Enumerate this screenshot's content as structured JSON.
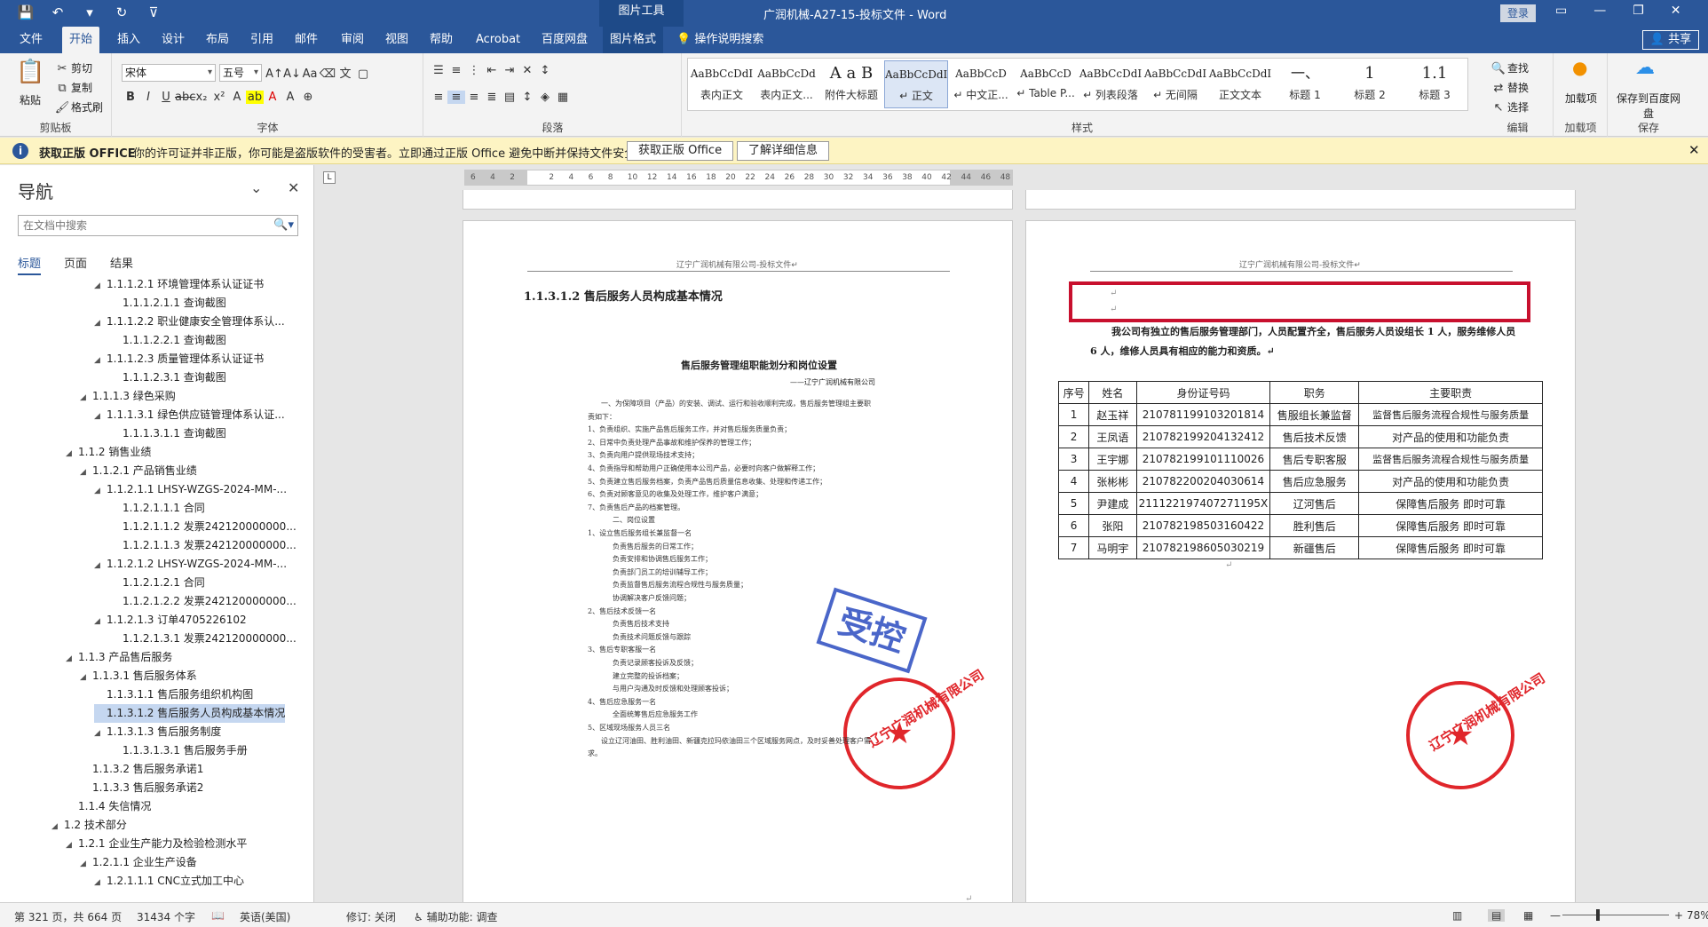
{
  "titlebar": {
    "qat": [
      "💾",
      "↶",
      "▾",
      "↻",
      "⊽"
    ],
    "context_header": "图片工具",
    "doc_title": "广润机械-A27-15-投标文件  -  Word",
    "login": "登录",
    "controls": [
      "▭",
      "—",
      "❐",
      "✕"
    ]
  },
  "tabs": [
    "文件",
    "开始",
    "插入",
    "设计",
    "布局",
    "引用",
    "邮件",
    "审阅",
    "视图",
    "帮助",
    "Acrobat",
    "百度网盘",
    "图片格式"
  ],
  "active_tab": "开始",
  "tell_me": "操作说明搜索",
  "share": "共享",
  "ribbon": {
    "clipboard": {
      "paste": "粘贴",
      "cut": "剪切",
      "copy": "复制",
      "format_painter": "格式刷",
      "label": "剪贴板"
    },
    "font": {
      "name": "宋体",
      "size": "五号",
      "label": "字体"
    },
    "paragraph": {
      "label": "段落"
    },
    "styles": {
      "label": "样式",
      "items": [
        {
          "sample": "AaBbCcDdI",
          "name": "表内正文"
        },
        {
          "sample": "AaBbCcDd",
          "name": "表内正文..."
        },
        {
          "sample": "A a B",
          "name": "附件大标题"
        },
        {
          "sample": "AaBbCcDdI",
          "name": "↵ 正文"
        },
        {
          "sample": "AaBbCcD",
          "name": "↵ 中文正..."
        },
        {
          "sample": "AaBbCcD",
          "name": "↵ Table P..."
        },
        {
          "sample": "AaBbCcDdI",
          "name": "↵ 列表段落"
        },
        {
          "sample": "AaBbCcDdI",
          "name": "↵ 无间隔"
        },
        {
          "sample": "AaBbCcDdI",
          "name": "正文文本"
        },
        {
          "sample": "一、",
          "name": "标题 1"
        },
        {
          "sample": "1",
          "name": "标题 2"
        },
        {
          "sample": "1.1",
          "name": "标题 3"
        }
      ]
    },
    "editing": {
      "find": "查找",
      "replace": "替换",
      "select": "选择",
      "label": "编辑"
    },
    "addins": {
      "addin": "加载项",
      "label": "加载项"
    },
    "save": {
      "save_baidu": "保存到百度网盘",
      "label": "保存"
    }
  },
  "infobar": {
    "title": "获取正版 OFFICE",
    "message": "你的许可证并非正版，你可能是盗版软件的受害者。立即通过正版 Office 避免中断并保持文件安全。",
    "btn_genuine": "获取正版 Office",
    "btn_learn": "了解详细信息"
  },
  "nav": {
    "title": "导航",
    "search_placeholder": "在文档中搜索",
    "tabs": [
      "标题",
      "页面",
      "结果"
    ],
    "items": [
      {
        "level": 3,
        "expand": true,
        "text": "1.1.1.2.1 环境管理体系认证证书"
      },
      {
        "level": 4,
        "expand": false,
        "text": "1.1.1.2.1.1 查询截图"
      },
      {
        "level": 3,
        "expand": true,
        "text": "1.1.1.2.2 职业健康安全管理体系认..."
      },
      {
        "level": 4,
        "expand": false,
        "text": "1.1.1.2.2.1 查询截图"
      },
      {
        "level": 3,
        "expand": true,
        "text": "1.1.1.2.3 质量管理体系认证证书"
      },
      {
        "level": 4,
        "expand": false,
        "text": "1.1.1.2.3.1 查询截图"
      },
      {
        "level": 2,
        "expand": true,
        "text": "1.1.1.3 绿色采购"
      },
      {
        "level": 3,
        "expand": true,
        "text": "1.1.1.3.1 绿色供应链管理体系认证..."
      },
      {
        "level": 4,
        "expand": false,
        "text": "1.1.1.3.1.1 查询截图"
      },
      {
        "level": 1,
        "expand": true,
        "text": "1.1.2 销售业绩"
      },
      {
        "level": 2,
        "expand": true,
        "text": "1.1.2.1 产品销售业绩"
      },
      {
        "level": 3,
        "expand": true,
        "text": "1.1.2.1.1 LHSY-WZGS-2024-MM-..."
      },
      {
        "level": 4,
        "expand": false,
        "text": "1.1.2.1.1.1 合同"
      },
      {
        "level": 4,
        "expand": false,
        "text": "1.1.2.1.1.2 发票242120000000..."
      },
      {
        "level": 4,
        "expand": false,
        "text": "1.1.2.1.1.3 发票242120000000..."
      },
      {
        "level": 3,
        "expand": true,
        "text": "1.1.2.1.2 LHSY-WZGS-2024-MM-..."
      },
      {
        "level": 4,
        "expand": false,
        "text": "1.1.2.1.2.1 合同"
      },
      {
        "level": 4,
        "expand": false,
        "text": "1.1.2.1.2.2 发票242120000000..."
      },
      {
        "level": 3,
        "expand": true,
        "text": "1.1.2.1.3 订单4705226102"
      },
      {
        "level": 4,
        "expand": false,
        "text": "1.1.2.1.3.1 发票242120000000..."
      },
      {
        "level": 1,
        "expand": true,
        "text": "1.1.3 产品售后服务"
      },
      {
        "level": 2,
        "expand": true,
        "text": "1.1.3.1 售后服务体系"
      },
      {
        "level": 3,
        "expand": false,
        "text": "1.1.3.1.1 售后服务组织机构图"
      },
      {
        "level": 3,
        "expand": false,
        "text": "1.1.3.1.2 售后服务人员构成基本情况",
        "selected": true
      },
      {
        "level": 3,
        "expand": true,
        "text": "1.1.3.1.3 售后服务制度"
      },
      {
        "level": 4,
        "expand": false,
        "text": "1.1.3.1.3.1 售后服务手册"
      },
      {
        "level": 2,
        "expand": false,
        "text": "1.1.3.2 售后服务承诺1"
      },
      {
        "level": 2,
        "expand": false,
        "text": "1.1.3.3 售后服务承诺2"
      },
      {
        "level": 1,
        "expand": false,
        "text": "1.1.4 失信情况"
      },
      {
        "level": 0,
        "expand": true,
        "text": "1.2 技术部分"
      },
      {
        "level": 1,
        "expand": true,
        "text": "1.2.1 企业生产能力及检验检测水平"
      },
      {
        "level": 2,
        "expand": true,
        "text": "1.2.1.1 企业生产设备"
      },
      {
        "level": 3,
        "expand": true,
        "text": "1.2.1.1.1 CNC立式加工中心"
      }
    ]
  },
  "ruler": [
    "6",
    "4",
    "2",
    "",
    "2",
    "4",
    "6",
    "8",
    "10",
    "12",
    "14",
    "16",
    "18",
    "20",
    "22",
    "24",
    "26",
    "28",
    "30",
    "32",
    "34",
    "36",
    "38",
    "40",
    "42",
    "44",
    "46",
    "48"
  ],
  "left_page": {
    "header": "辽宁广润机械有限公司-投标文件↵",
    "heading": "1.1.3.1.2  售后服务人员构成基本情况",
    "org_title": "售后服务管理组职能划分和岗位设置",
    "org_company": "——辽宁广润机械有限公司",
    "lines": [
      "一、为保障项目（产品）的安装、调试、运行和验收顺利完成，售后服务管理组主要职",
      "责如下：",
      "1、负责组织、实施产品售后服务工作，并对售后服务质量负责；",
      "2、日常中负责处理产品事故和维护保养的管理工作；",
      "3、负责向用户提供现场技术支持；",
      "4、负责指导和帮助用户正确使用本公司产品，必要时向客户做解释工作；",
      "5、负责建立售后服务档案，负责产品售后质量信息收集、处理和传递工作；",
      "6、负责对顾客意见的收集及处理工作，维护客户满意；",
      "7、负责售后产品的档案管理。",
      "二、岗位设置",
      "1、设立售后服务组长兼监督一名",
      "负责售后服务的日常工作；",
      "负责安排和协调售后服务工作；",
      "负责部门员工的培训辅导工作；",
      "负责监督售后服务流程合规性与服务质量；",
      "协调解决客户反馈问题；",
      "2、售后技术反馈一名",
      "负责售后技术支持",
      "负责技术问题反馈与跟踪",
      "3、售后专职客服一名",
      "负责记录顾客投诉及反馈；",
      "建立完整的投诉档案；",
      "与用户沟通及时反馈和处理顾客投诉；",
      "4、售后应急服务一名",
      "全面统筹售后应急服务工作",
      "5、区域现场服务人员三名",
      "设立辽河油田、胜利油田、新疆克拉玛依油田三个区域服务网点，及时妥善处理客户需",
      "求。"
    ],
    "ctrl_stamp": "受控",
    "seal_text": "辽宁广润机械有限公司"
  },
  "right_page": {
    "header": "辽宁广润机械有限公司-投标文件↵",
    "intro_1": "我公司有独立的售后服务管理部门，人员配置齐全，售后服务人员设组长 1 人，服务维修人员",
    "intro_2": "6 人，维修人员具有相应的能力和资质。↵",
    "table_headers": [
      "序号",
      "姓名",
      "身份证号码",
      "职务",
      "主要职责"
    ],
    "table_rows": [
      [
        "1",
        "赵玉祥",
        "210781199103201814",
        "售服组长兼监督",
        "监督售后服务流程合规性与服务质量"
      ],
      [
        "2",
        "王凤语",
        "210782199204132412",
        "售后技术反馈",
        "对产品的使用和功能负责"
      ],
      [
        "3",
        "王宇娜",
        "210782199101110026",
        "售后专职客服",
        "监督售后服务流程合规性与服务质量"
      ],
      [
        "4",
        "张彬彬",
        "210782200204030614",
        "售后应急服务",
        "对产品的使用和功能负责"
      ],
      [
        "5",
        "尹建成",
        "211122197407271195X",
        "辽河售后",
        "保障售后服务 即时可靠"
      ],
      [
        "6",
        "张阳",
        "210782198503160422",
        "胜利售后",
        "保障售后服务 即时可靠"
      ],
      [
        "7",
        "马明宇",
        "210782198605030219",
        "新疆售后",
        "保障售后服务 即时可靠"
      ]
    ],
    "seal_text": "辽宁广润机械有限公司"
  },
  "status": {
    "page": "第 321 页，共 664 页",
    "words": "31434 个字",
    "lang": "英语(美国)",
    "track": "修订: 关闭",
    "access": "辅助功能: 调查",
    "zoom": "78%"
  },
  "colors": {
    "word_blue": "#2b579a",
    "seal_red": "#e0262b",
    "stamp_blue": "#4a66c9",
    "sel_box": "#c8102e"
  }
}
